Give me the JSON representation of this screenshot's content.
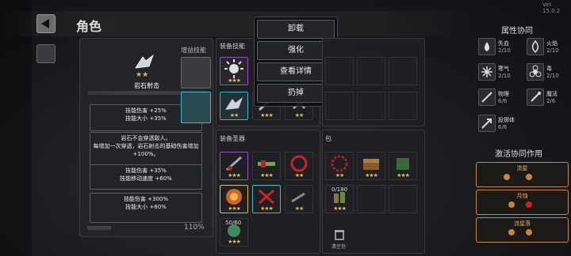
{
  "version": "Ver. 15.0.2",
  "title": "角色",
  "skill_card": {
    "tab_label": "增益技能",
    "skill_name": "岩石射击",
    "level_stars": 2,
    "effects": [
      "技能伤害 +25%\n技能大小 +35%",
      "岩石不会穿透敌人。\n每增加一次穿透，岩石射击的基础伤害增加\n+100%。",
      "技能伤害 +35%\n技能移动速度 +60%",
      "技能伤害 +300%\n技能大小 +60%"
    ],
    "footer_stat": "110%"
  },
  "context_menu": {
    "items": [
      "卸载",
      "强化",
      "查看详情",
      "扔掉"
    ]
  },
  "equipped_skills": {
    "label": "装备技能"
  },
  "equipped_gear": {
    "label": "装备圣器"
  },
  "bag": {
    "label": "包",
    "capacity": "0/180",
    "count": "50/60",
    "clear_label": "清空包"
  },
  "synergy": {
    "title": "属性协同",
    "items": [
      {
        "name": "失血",
        "count": "2/10",
        "icon": "blood-drop-icon"
      },
      {
        "name": "火焰",
        "count": "2/10",
        "icon": "flame-icon"
      },
      {
        "name": "寒气",
        "count": "2/10",
        "icon": "snowflake-icon"
      },
      {
        "name": "毒",
        "count": "2/10",
        "icon": "biohazard-icon"
      },
      {
        "name": "物理",
        "count": "6/6",
        "icon": "sword-icon"
      },
      {
        "name": "魔法",
        "count": "2/6",
        "icon": "wand-icon"
      },
      {
        "name": "投掷体",
        "count": "6/6",
        "icon": "throw-icon"
      }
    ]
  },
  "active_synergy": {
    "title": "激活协同作用",
    "items": [
      "流星",
      "月蚀",
      "流星落"
    ]
  },
  "colors": {
    "accent": "#c98b3a",
    "star": "#e8b84a",
    "frame_cyan": "#3fb7c9",
    "frame_purple": "#9b4fc0"
  }
}
